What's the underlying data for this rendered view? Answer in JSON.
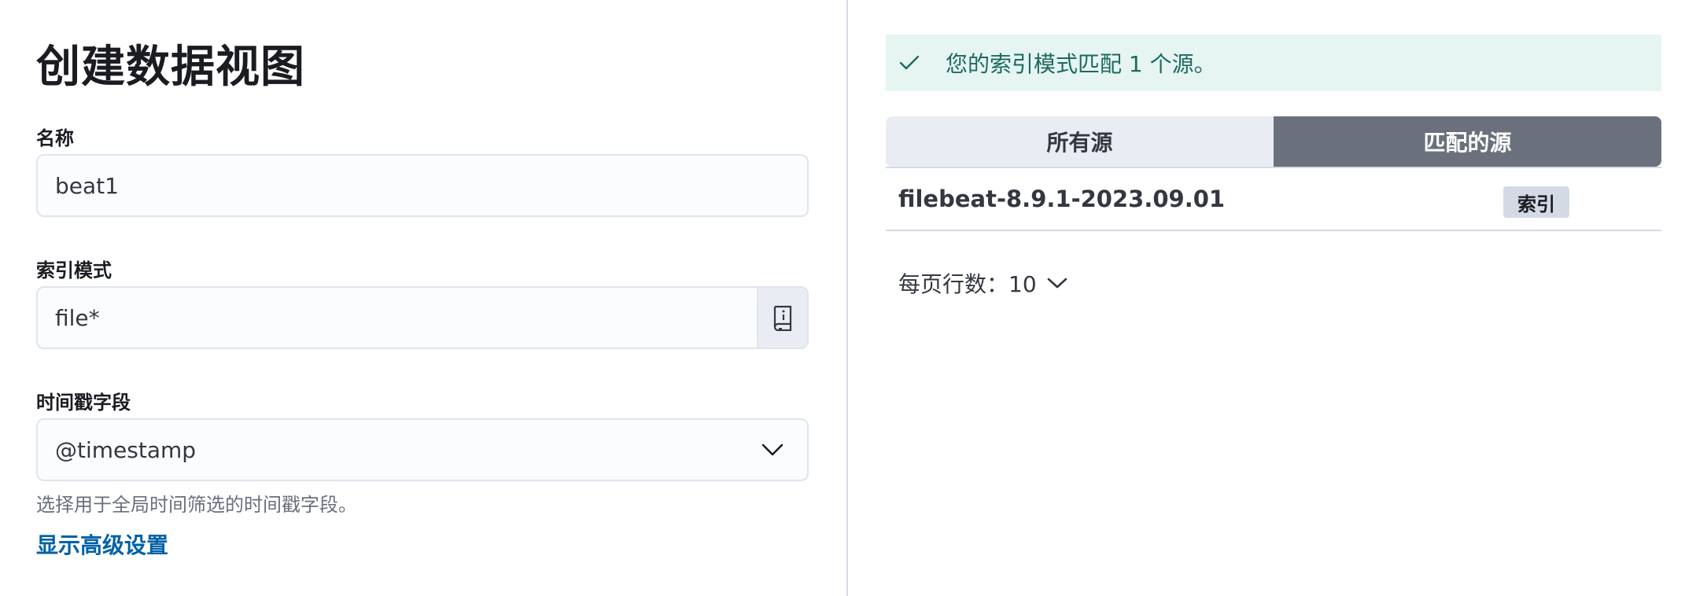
{
  "form": {
    "title": "创建数据视图",
    "name_label": "名称",
    "name_value": "beat1",
    "pattern_label": "索引模式",
    "pattern_value": "file*",
    "timestamp_label": "时间戳字段",
    "timestamp_value": "@timestamp",
    "timestamp_help": "选择用于全局时间筛选的时间戳字段。",
    "advanced_link": "显示高级设置"
  },
  "results": {
    "callout_text": "您的索引模式匹配 1 个源。",
    "tabs": [
      {
        "label": "所有源",
        "selected": false
      },
      {
        "label": "匹配的源",
        "selected": true
      }
    ],
    "rows": [
      {
        "name": "filebeat-8.9.1-2023.09.01",
        "badge": "索引"
      }
    ],
    "rows_per_page": "每页行数：10"
  },
  "icons": {
    "callout": "check-icon",
    "pattern_append": "book-info-icon",
    "select": "chevron-down-icon"
  },
  "colors": {
    "success_bg": "#e6f5f2",
    "success_text": "#1d6a5e",
    "link": "#0061a6",
    "selected_tab": "#6a717d"
  }
}
